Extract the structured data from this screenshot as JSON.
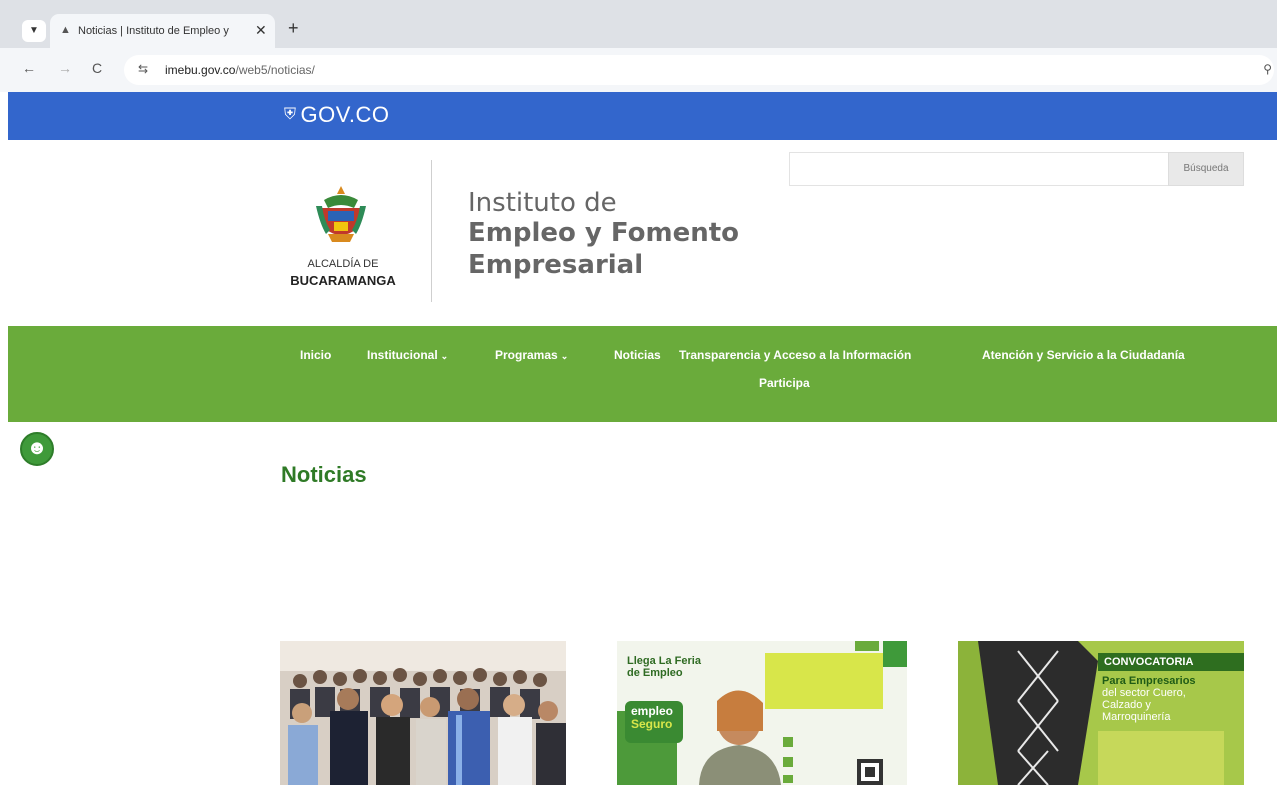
{
  "browser": {
    "tab_title": "Noticias | Instituto de Empleo y",
    "tab_menu_icon": "chevron-down-icon",
    "tab_close": "✕",
    "new_tab": "+",
    "back": "←",
    "forward": "→",
    "reload": "C",
    "url_domain": "imebu.gov.co",
    "url_path": "/web5/noticias/",
    "zoom_icon": "⚲"
  },
  "govbar": {
    "logo_text": "GOV.CO",
    "color": "#3366cc"
  },
  "header": {
    "search_placeholder": "",
    "search_button": "Búsqueda",
    "alcaldia_line1": "ALCALDÍA DE",
    "alcaldia_line2": "BUCARAMANGA",
    "institute_line1": "Instituto de",
    "institute_line2": "Empleo y Fomento",
    "institute_line3": "Empresarial"
  },
  "nav": {
    "color": "#6aab3b",
    "items": [
      {
        "label": "Inicio"
      },
      {
        "label": "Institucional"
      },
      {
        "label": "Programas"
      },
      {
        "label": "Noticias"
      },
      {
        "label": "Transparencia y Acceso a la Información"
      },
      {
        "label": "Atención y Servicio a la Ciudadanía"
      },
      {
        "label": "Participa"
      }
    ]
  },
  "page": {
    "title": "Noticias",
    "title_color": "#2f7a26"
  },
  "cards": [
    {
      "image": "group-photo"
    },
    {
      "line1": "Llega La Feria",
      "line2": "de Empleo",
      "badge_top": "empleo",
      "badge_bottom": "Seguro"
    },
    {
      "banner": "CONVOCATORIA",
      "line1": "Para Empresarios",
      "line2": "del sector Cuero,",
      "line3": "Calzado y",
      "line4": "Marroquinería"
    }
  ]
}
